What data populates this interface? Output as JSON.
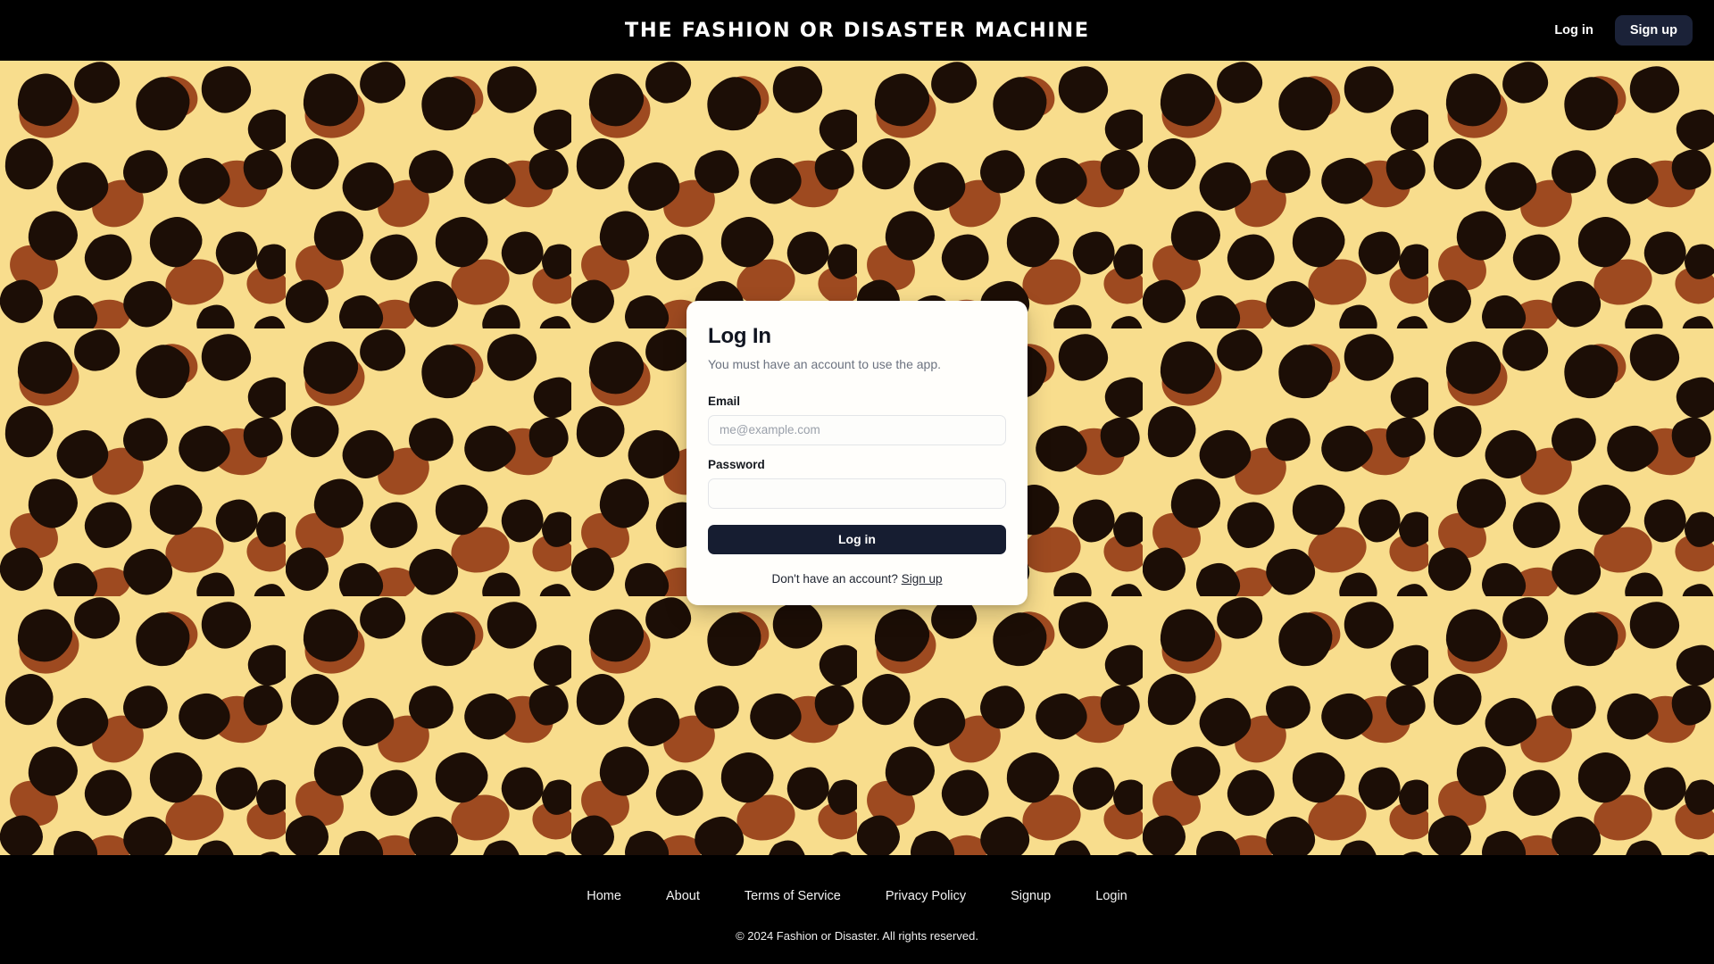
{
  "header": {
    "brand_title": "THE FASHION OR DISASTER MACHINE",
    "login_label": "Log in",
    "signup_label": "Sign up",
    "background_color": "#000000",
    "signup_button_color": "#1b2238"
  },
  "background": {
    "pattern_name": "leopard-print",
    "base_color": "#f8dd8d",
    "spot_dark_color": "#1c0e06",
    "spot_brown_color": "#9e4a20"
  },
  "login_card": {
    "title": "Log In",
    "subtitle": "You must have an account to use the app.",
    "email_label": "Email",
    "email_placeholder": "me@example.com",
    "email_value": "",
    "password_label": "Password",
    "password_placeholder": "",
    "password_value": "",
    "submit_label": "Log in",
    "submit_color": "#161d31",
    "footer_prompt": "Don't have an account?",
    "footer_link_label": "Sign up",
    "card_color": "#fffefb"
  },
  "footer": {
    "links": [
      {
        "label": "Home"
      },
      {
        "label": "About"
      },
      {
        "label": "Terms of Service"
      },
      {
        "label": "Privacy Policy"
      },
      {
        "label": "Signup"
      },
      {
        "label": "Login"
      }
    ],
    "copyright": "© 2024 Fashion or Disaster. All rights reserved.",
    "background_color": "#000000"
  }
}
